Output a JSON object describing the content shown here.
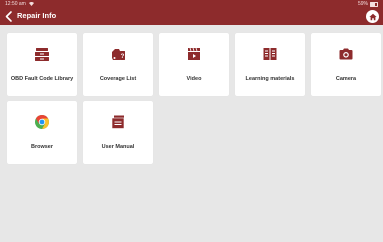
{
  "status_bar": {
    "time": "12:50 am",
    "battery": "59%"
  },
  "header": {
    "title": "Repair Info"
  },
  "tiles": [
    {
      "label": "OBD Fault Code Library",
      "icon": "drawer-icon"
    },
    {
      "label": "Coverage List",
      "icon": "car-question-icon"
    },
    {
      "label": "Video",
      "icon": "clapperboard-icon"
    },
    {
      "label": "Learning materials",
      "icon": "book-icon"
    },
    {
      "label": "Camera",
      "icon": "camera-icon"
    },
    {
      "label": "Browser",
      "icon": "chrome-icon"
    },
    {
      "label": "User Manual",
      "icon": "manual-icon"
    }
  ],
  "colors": {
    "header": "#8d2b2c",
    "background": "#e7e7e7",
    "icon": "#8d2b2c"
  }
}
